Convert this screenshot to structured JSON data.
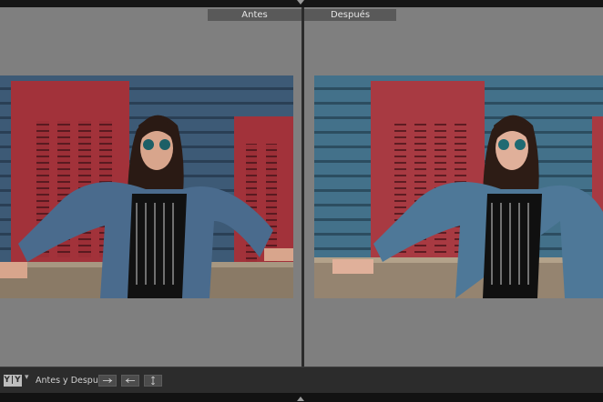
{
  "views": {
    "before_label": "Antes",
    "after_label": "Después"
  },
  "toolbar": {
    "view_mode_label": "Y|Y",
    "before_after_label": "Antes y Después:",
    "buttons": [
      "copy-before-to-after-icon",
      "copy-after-to-before-icon",
      "swap-before-after-icon"
    ]
  },
  "colors": {
    "panel_bg": "#7f7f7f",
    "label_bg": "#595959",
    "toolbar_bg": "#2c2c2c",
    "before_wall": "#3d5a76",
    "after_wall": "#43718a",
    "door_red": "#a2323a"
  }
}
